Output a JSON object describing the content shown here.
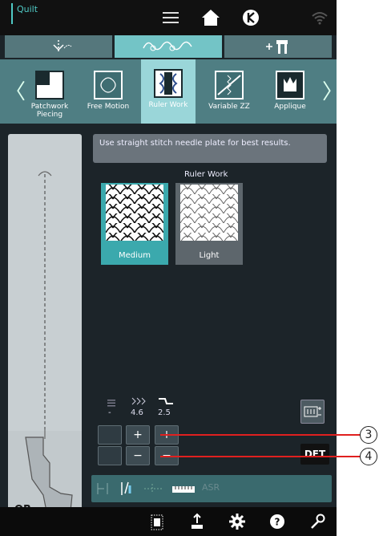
{
  "topbar": {
    "mode_label": "Quilt",
    "icons": [
      "menu-icon",
      "home-icon",
      "jumpstart-icon",
      "wifi-icon"
    ]
  },
  "category_tabs": [
    {
      "icon": "free-stitch-icon",
      "active": false
    },
    {
      "icon": "decorative-stitch-icon",
      "active": true
    },
    {
      "icon": "add-foot-icon",
      "active": false
    }
  ],
  "techniques": [
    {
      "label": "Patchwork Piecing",
      "icon": "patchwork-icon"
    },
    {
      "label": "Free Motion",
      "icon": "free-motion-icon"
    },
    {
      "label": "Ruler Work",
      "icon": "ruler-work-icon",
      "active": true
    },
    {
      "label": "Variable ZZ",
      "icon": "variable-zz-icon"
    },
    {
      "label": "Applique",
      "icon": "applique-icon"
    }
  ],
  "message": "Use straight stitch needle plate for best results.",
  "ruler_work": {
    "title": "Ruler Work",
    "options": [
      {
        "label": "Medium",
        "selected": true
      },
      {
        "label": "Light",
        "selected": false
      }
    ]
  },
  "settings": {
    "width": {
      "value": "-",
      "icon": "stitch-width-icon"
    },
    "density": {
      "value": "4.6",
      "icon": "stitch-density-icon"
    },
    "length": {
      "value": "2.5",
      "icon": "stitch-length-icon"
    }
  },
  "stepper": {
    "plus": "+",
    "minus": "−"
  },
  "dft_label": "DFT",
  "presser_foot_label": "QR",
  "bottom_row": {
    "asr_label": "ASR"
  },
  "footer_icons": [
    "stitch-pattern-icon",
    "export-icon",
    "settings-icon",
    "help-icon",
    "tools-icon"
  ],
  "callouts": [
    "3",
    "4"
  ]
}
